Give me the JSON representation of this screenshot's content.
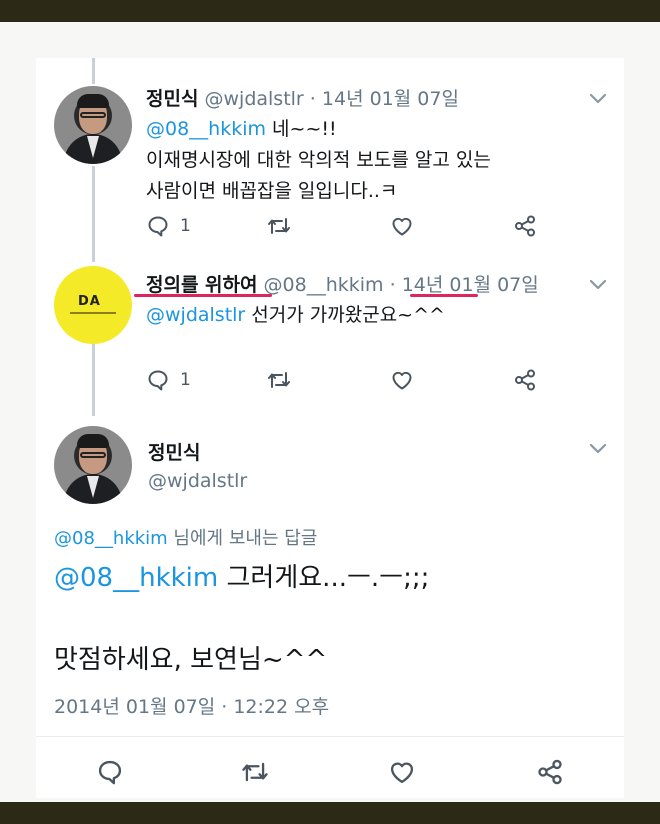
{
  "tweet1": {
    "name": "정민식",
    "handle": "@wjdalstlr",
    "dot": "·",
    "date": "14년 01월 07일",
    "mention": "@08__hkkim",
    "text_tail": " 네~~!!",
    "line2": "이재명시장에 대한 악의적 보도를 알고 있는",
    "line3": "사람이면 배꼽잡을 일입니다..ㅋ",
    "reply_count": "1"
  },
  "tweet2": {
    "name": "정의를 위하여",
    "handle": "@08__hkkim",
    "dot": "·",
    "date": "14년 01월 07일",
    "mention": "@wjdalstlr",
    "text_tail": " 선거가 가까왔군요~^^",
    "reply_count": "1",
    "avatar_mark": "DA"
  },
  "tweet3": {
    "name": "정민식",
    "handle": "@wjdalstlr",
    "reply_to_handle": "@08__hkkim",
    "reply_to_suffix": " 님에게 보내는 답글",
    "mention": "@08__hkkim",
    "text_tail": " 그러게요...ㅡ.ㅡ;;;",
    "line2": "맛점하세요,  보연님~^^",
    "timestamp": "2014년 01월 07일 · 12:22 오후"
  },
  "colors": {
    "link": "#1b95e0",
    "meta": "#657786",
    "highlight": "#e0245e",
    "thread_line": "#c8d1d8",
    "frame_band": "#2c2a17",
    "avatar_yellow": "#f5ea28"
  },
  "icons": [
    "chevron-down-icon",
    "reply-icon",
    "retweet-icon",
    "like-icon",
    "share-icon"
  ]
}
